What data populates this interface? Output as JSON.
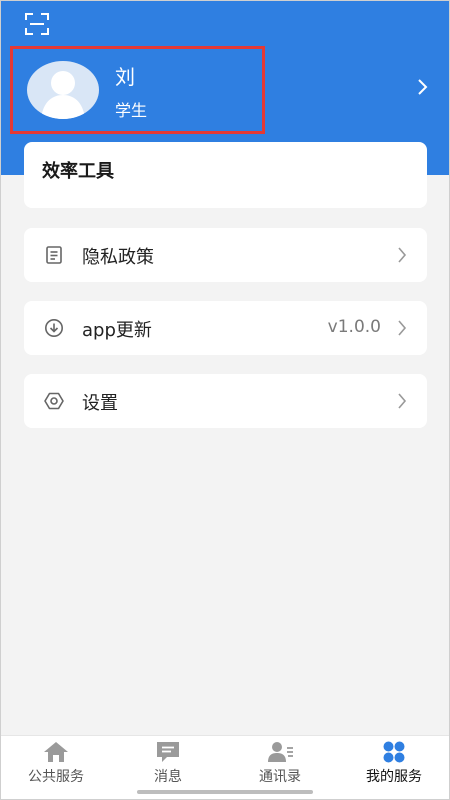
{
  "header": {
    "user": {
      "name": "刘",
      "role": "学生"
    },
    "accent_color": "#2f7fe1",
    "scan_icon": "scan-icon",
    "chevron_icon": "chevron-right-icon"
  },
  "tools": {
    "title": "效率工具"
  },
  "menu": [
    {
      "label": "隐私政策",
      "icon": "document-icon",
      "value": ""
    },
    {
      "label": "app更新",
      "icon": "download-icon",
      "value": "v1.0.0"
    },
    {
      "label": "设置",
      "icon": "gear-icon",
      "value": ""
    }
  ],
  "tabs": [
    {
      "label": "公共服务",
      "icon": "home-icon",
      "active": false
    },
    {
      "label": "消息",
      "icon": "message-icon",
      "active": false
    },
    {
      "label": "通讯录",
      "icon": "contacts-icon",
      "active": false
    },
    {
      "label": "我的服务",
      "icon": "grid-icon",
      "active": true
    }
  ]
}
